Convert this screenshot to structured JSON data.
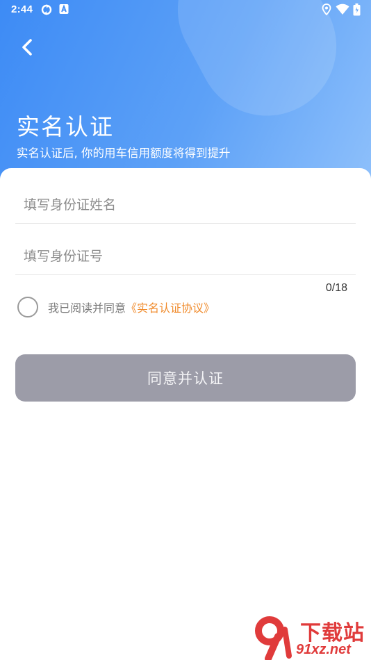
{
  "status_bar": {
    "time": "2:44",
    "left_icons": [
      "sync-icon",
      "a-badge-icon"
    ],
    "right_icons": [
      "location-icon",
      "wifi-icon",
      "battery-icon"
    ]
  },
  "header": {
    "back_icon": "chevron-left-icon",
    "title": "实名认证",
    "subtitle": "实名认证后, 你的用车信用额度将得到提升"
  },
  "form": {
    "name_placeholder": "填写身份证姓名",
    "name_value": "",
    "id_placeholder": "填写身份证号",
    "id_value": "",
    "id_counter": "0/18",
    "agree_checked": false,
    "agree_text": "我已阅读并同意",
    "agree_link": "《实名认证协议》",
    "submit_label": "同意并认证"
  },
  "watermark": {
    "top": "下载站",
    "bottom": "91xz.net"
  },
  "colors": {
    "accent_blue": "#3d8bf5",
    "link_orange": "#f08a2a",
    "button_disabled": "#9c9ca8",
    "watermark_red": "#e03b3b"
  }
}
